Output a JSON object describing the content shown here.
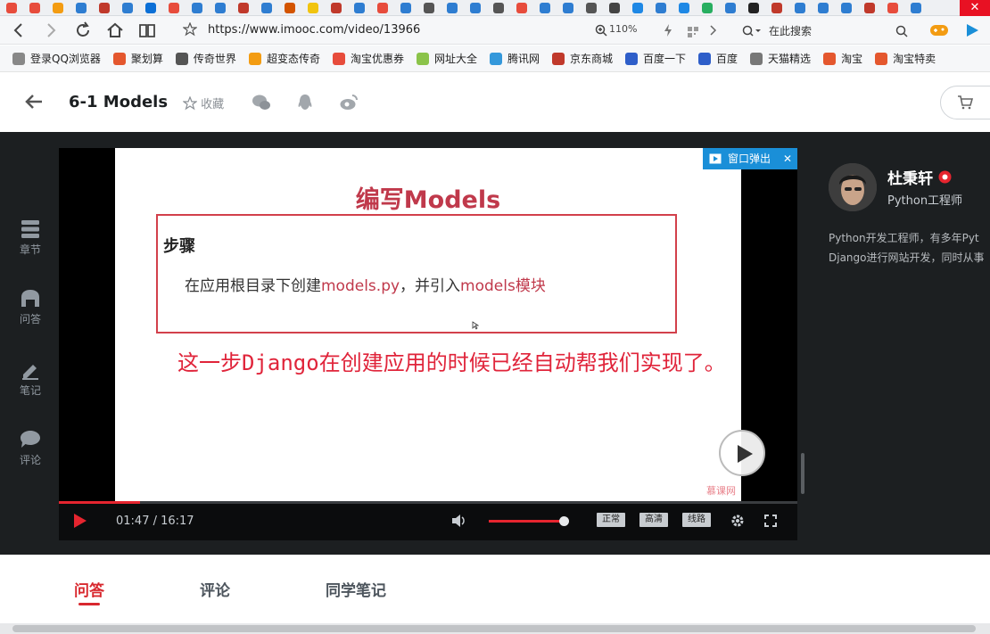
{
  "browser": {
    "url": "https://www.imooc.com/video/13966",
    "zoom": "110%",
    "search_placeholder": "在此搜索",
    "close_glyph": "✕",
    "tab_colors": [
      "#e74c3c",
      "#e74c3c",
      "#f39c12",
      "#2e7dd1",
      "#c0392b",
      "#2e7dd1",
      "#0b6fd6",
      "#e74c3c",
      "#2e7dd1",
      "#2e7dd1",
      "#c0392b",
      "#2e7dd1",
      "#d35400",
      "#f1c40f",
      "#c0392b",
      "#2e7dd1",
      "#e74c3c",
      "#2e7dd1",
      "#555555",
      "#2e7dd1",
      "#2e7dd1",
      "#555555",
      "#e74c3c",
      "#2e7dd1",
      "#2e7dd1",
      "#555555",
      "#444444",
      "#1e88e5",
      "#2e7dd1",
      "#1e88e5",
      "#27ae60",
      "#2e7dd1",
      "#222222",
      "#c0392b",
      "#2e7dd1",
      "#2e7dd1",
      "#2e7dd1",
      "#c0392b",
      "#e74c3c",
      "#2e7dd1"
    ]
  },
  "bookmarks": [
    {
      "label": "登录QQ浏览器",
      "color": "#888888"
    },
    {
      "label": "聚划算",
      "color": "#e4572e"
    },
    {
      "label": "传奇世界",
      "color": "#555555"
    },
    {
      "label": "超变态传奇",
      "color": "#f39c12"
    },
    {
      "label": "淘宝优惠券",
      "color": "#e74c3c"
    },
    {
      "label": "网址大全",
      "color": "#8bc34a"
    },
    {
      "label": "腾讯网",
      "color": "#3498db"
    },
    {
      "label": "京东商城",
      "color": "#c0392b"
    },
    {
      "label": "百度一下",
      "color": "#2e5ec9"
    },
    {
      "label": "百度",
      "color": "#2e5ec9"
    },
    {
      "label": "天猫精选",
      "color": "#777777"
    },
    {
      "label": "淘宝",
      "color": "#e4572e"
    },
    {
      "label": "淘宝特卖",
      "color": "#e4572e"
    }
  ],
  "header": {
    "title": "6-1 Models",
    "favorite": "收藏"
  },
  "sidebar": {
    "items": [
      {
        "label": "章节"
      },
      {
        "label": "问答"
      },
      {
        "label": "笔记"
      },
      {
        "label": "评论"
      }
    ]
  },
  "video": {
    "popout_label": "窗口弹出",
    "slide": {
      "title": "编写Models",
      "step_label": "步骤",
      "line_prefix": "在应用根目录下创建",
      "line_file": "models.py",
      "line_mid": "，并引入",
      "line_module": "models模块",
      "note": "这一步Django在创建应用的时候已经自动帮我们实现了。",
      "watermark": "慕课网"
    },
    "time": "01:47 / 16:17",
    "progress": 0.11,
    "volume": 0.95,
    "quality_options": [
      "正常",
      "高清",
      "线路"
    ]
  },
  "teacher": {
    "name": "杜秉轩",
    "role": "Python工程师",
    "desc_line1": "Python开发工程师，有多年Pyt",
    "desc_line2": "Django进行网站开发，同时从事"
  },
  "bottom_tabs": [
    {
      "label": "问答",
      "active": true
    },
    {
      "label": "评论",
      "active": false
    },
    {
      "label": "同学笔记",
      "active": false
    }
  ]
}
